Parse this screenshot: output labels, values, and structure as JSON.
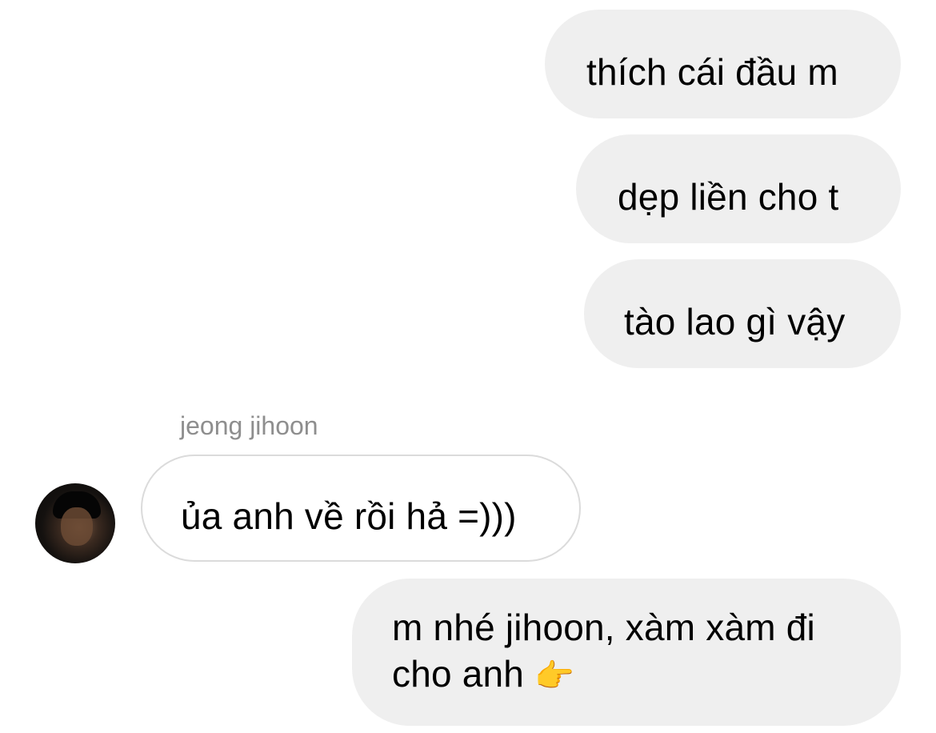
{
  "messages": [
    {
      "direction": "outgoing",
      "text": "thích cái đầu m"
    },
    {
      "direction": "outgoing",
      "text": "dẹp liền cho t"
    },
    {
      "direction": "outgoing",
      "text": "tào lao gì vậy"
    },
    {
      "direction": "incoming",
      "sender": "jeong jihoon",
      "text": "ủa anh về rồi hả =)))"
    },
    {
      "direction": "outgoing",
      "text": "m nhé jihoon, xàm xàm đi\ncho anh",
      "emoji": "👉",
      "emoji_icon": "pointing-hand-icon"
    }
  ],
  "colors": {
    "outgoing_bubble": "#efefef",
    "incoming_border": "#dbdbdb",
    "sender_name": "#8e8e8e"
  }
}
